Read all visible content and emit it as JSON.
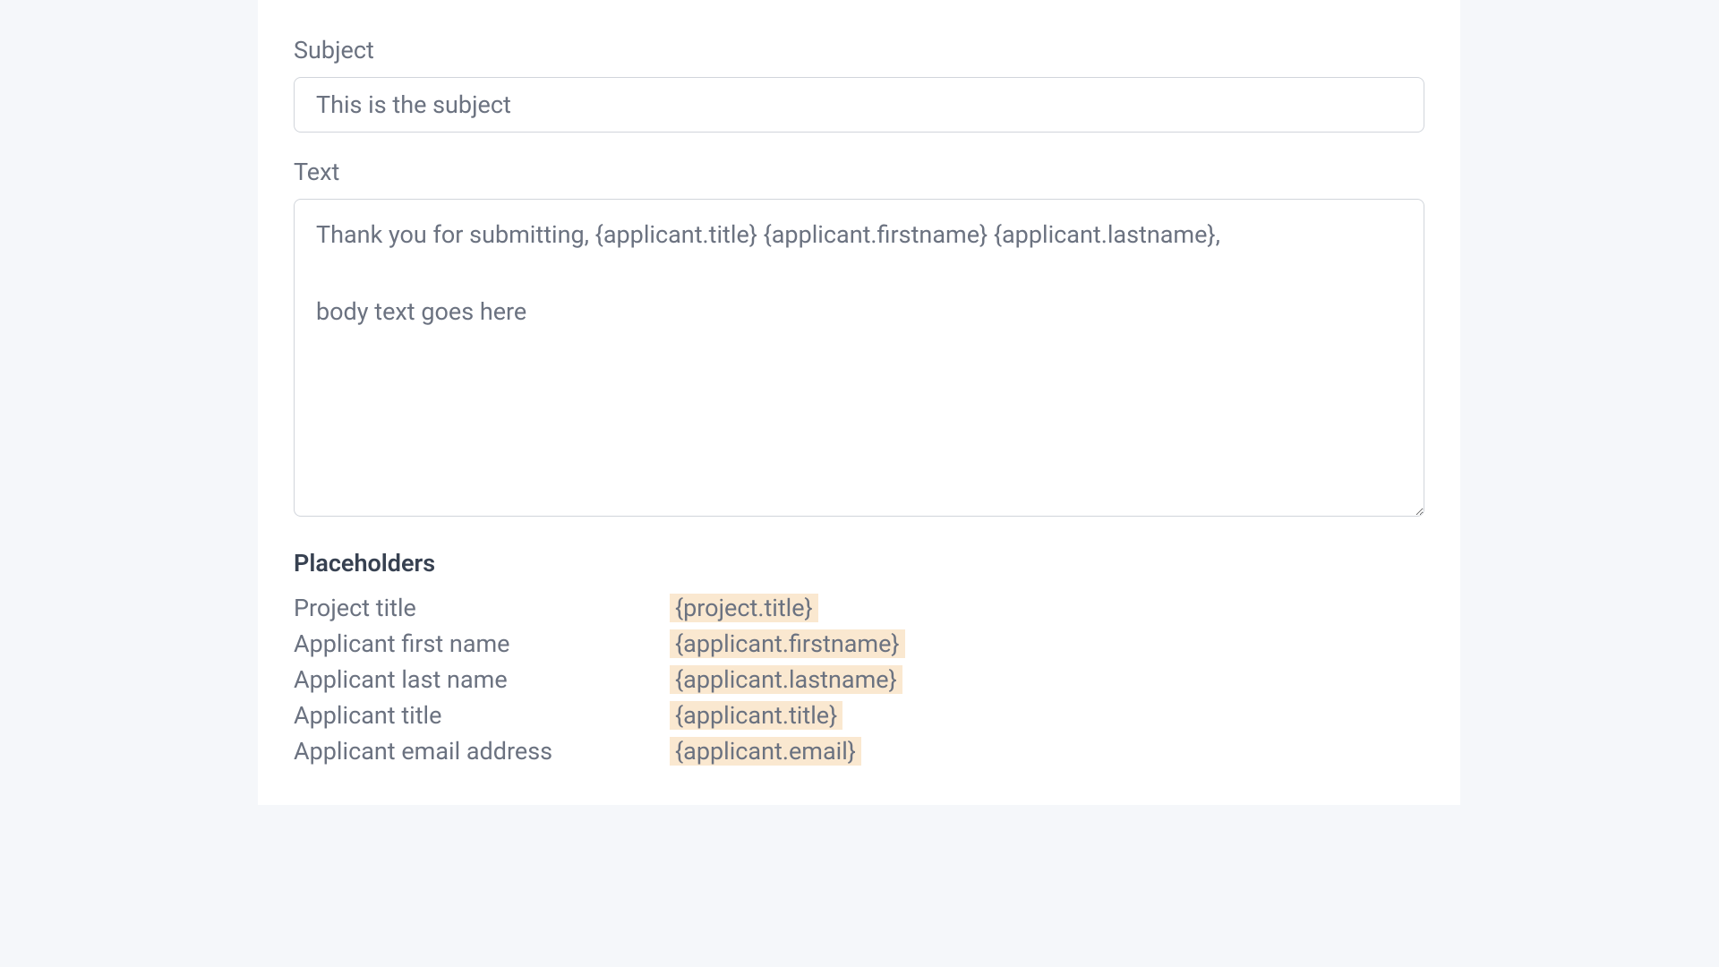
{
  "form": {
    "subject": {
      "label": "Subject",
      "value": "This is the subject"
    },
    "text": {
      "label": "Text",
      "value": "Thank you for submitting, {applicant.title} {applicant.firstname} {applicant.lastname},\n\nbody text goes here"
    }
  },
  "placeholders": {
    "heading": "Placeholders",
    "items": [
      {
        "label": "Project title",
        "token": "{project.title}"
      },
      {
        "label": "Applicant first name",
        "token": "{applicant.firstname}"
      },
      {
        "label": "Applicant last name",
        "token": "{applicant.lastname}"
      },
      {
        "label": "Applicant title",
        "token": "{applicant.title}"
      },
      {
        "label": "Applicant email address",
        "token": "{applicant.email}"
      }
    ]
  }
}
